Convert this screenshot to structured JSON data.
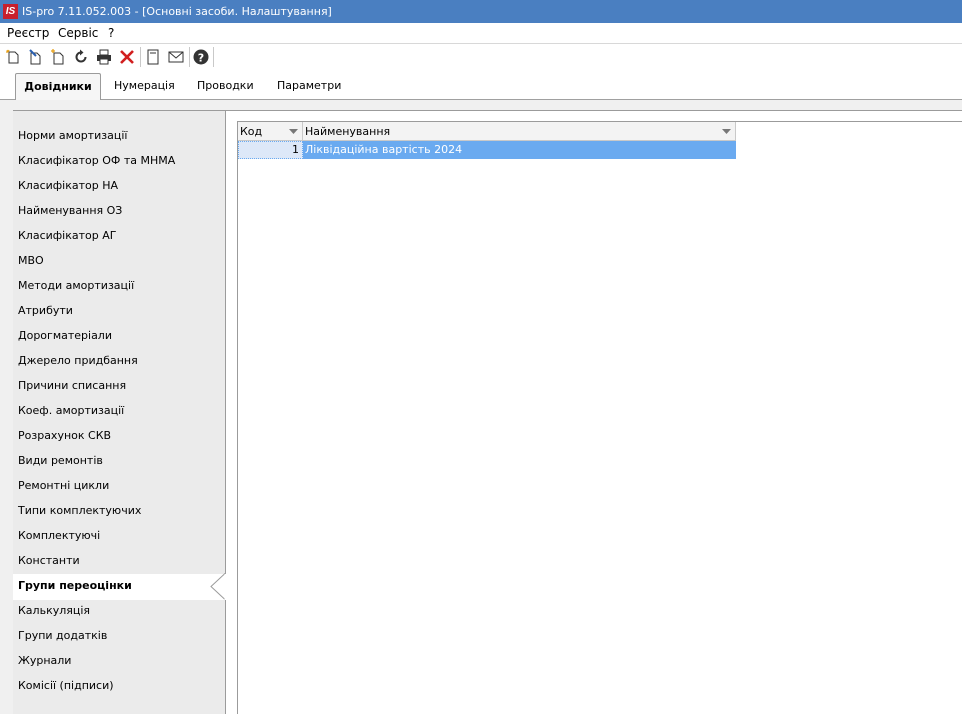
{
  "window": {
    "icon_text": "IS",
    "title": "IS-pro 7.11.052.003 - [Основні засоби. Налаштування]"
  },
  "menu": {
    "items": [
      {
        "label": "Реєстр"
      },
      {
        "label": "Сервіс"
      },
      {
        "label": "?"
      }
    ]
  },
  "toolbar": {
    "buttons": [
      {
        "icon": "new-document-icon"
      },
      {
        "icon": "edit-document-icon"
      },
      {
        "icon": "copy-document-icon"
      },
      {
        "icon": "refresh-icon"
      },
      {
        "icon": "print-icon"
      },
      {
        "icon": "delete-icon"
      },
      {
        "icon": "note-icon"
      },
      {
        "icon": "mail-icon"
      },
      {
        "icon": "help-icon"
      }
    ],
    "colors": {
      "delete": "#d11f1f",
      "icons": "#333333",
      "new": "#e8a21a"
    }
  },
  "tabs": [
    {
      "label": "Довідники",
      "active": true
    },
    {
      "label": "Нумерація",
      "active": false
    },
    {
      "label": "Проводки",
      "active": false
    },
    {
      "label": "Параметри",
      "active": false
    }
  ],
  "sidebar": {
    "items": [
      {
        "label": "Норми амортизації"
      },
      {
        "label": "Класифікатор ОФ та МНМА"
      },
      {
        "label": "Класифікатор НА"
      },
      {
        "label": "Найменування ОЗ"
      },
      {
        "label": "Класифікатор АГ"
      },
      {
        "label": "МВО"
      },
      {
        "label": "Методи амортизації"
      },
      {
        "label": "Атрибути"
      },
      {
        "label": "Дорогматеріали"
      },
      {
        "label": "Джерело придбання"
      },
      {
        "label": "Причини списання"
      },
      {
        "label": "Коеф. амортизації"
      },
      {
        "label": "Розрахунок СКВ"
      },
      {
        "label": "Види ремонтів"
      },
      {
        "label": "Ремонтні цикли"
      },
      {
        "label": "Типи комплектуючих"
      },
      {
        "label": "Комплектуючі"
      },
      {
        "label": "Константи"
      },
      {
        "label": "Групи переоцінки",
        "selected": true
      },
      {
        "label": "Калькуляція"
      },
      {
        "label": "Групи додатків"
      },
      {
        "label": "Журнали"
      },
      {
        "label": "Комісії (підписи)"
      }
    ]
  },
  "grid": {
    "columns": [
      {
        "label": "Код"
      },
      {
        "label": "Найменування"
      }
    ],
    "rows": [
      {
        "code": "1",
        "name": "Ліквідаційна вартість 2024",
        "selected": true
      }
    ],
    "colors": {
      "row_selected": "#6aaaf0",
      "cell_focus": "#dde8f8",
      "header_bg": "#f3f3f3"
    }
  }
}
